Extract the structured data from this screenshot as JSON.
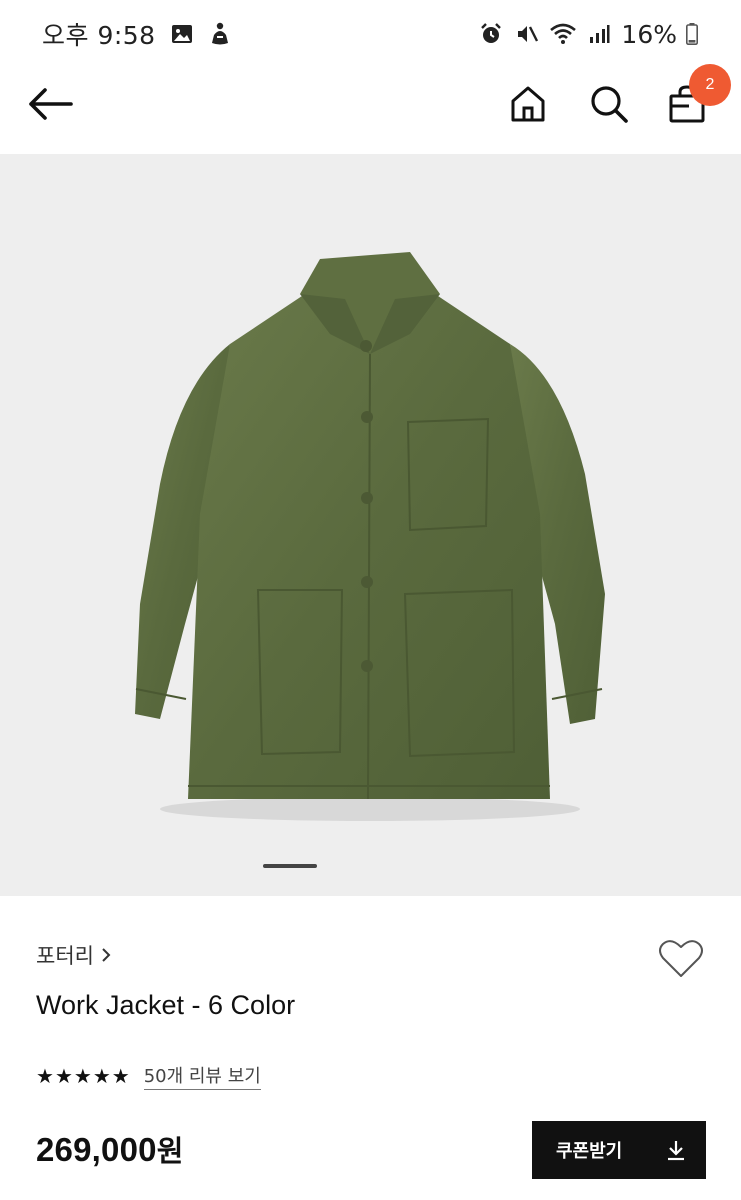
{
  "status_bar": {
    "time": "오후 9:58",
    "battery": "16%",
    "left_icons": [
      "gallery-icon",
      "app-notification-icon"
    ],
    "right_icons": [
      "alarm-icon",
      "mute-icon",
      "wifi-icon",
      "signal-icon",
      "battery-icon"
    ]
  },
  "header": {
    "cart_count": "2",
    "icons": [
      "back-arrow-icon",
      "home-icon",
      "search-icon",
      "shopping-bag-icon"
    ],
    "badge_color": "#ef5a32"
  },
  "product": {
    "image_background": "#eeeeee",
    "image_color": "#5a6b3e",
    "brand": "포터리",
    "name": "Work Jacket - 6 Color",
    "rating_stars": 5,
    "review_link": "50개 리뷰 보기",
    "price_amount": "269,000",
    "price_unit": "원",
    "coupon_label": "쿠폰받기"
  }
}
